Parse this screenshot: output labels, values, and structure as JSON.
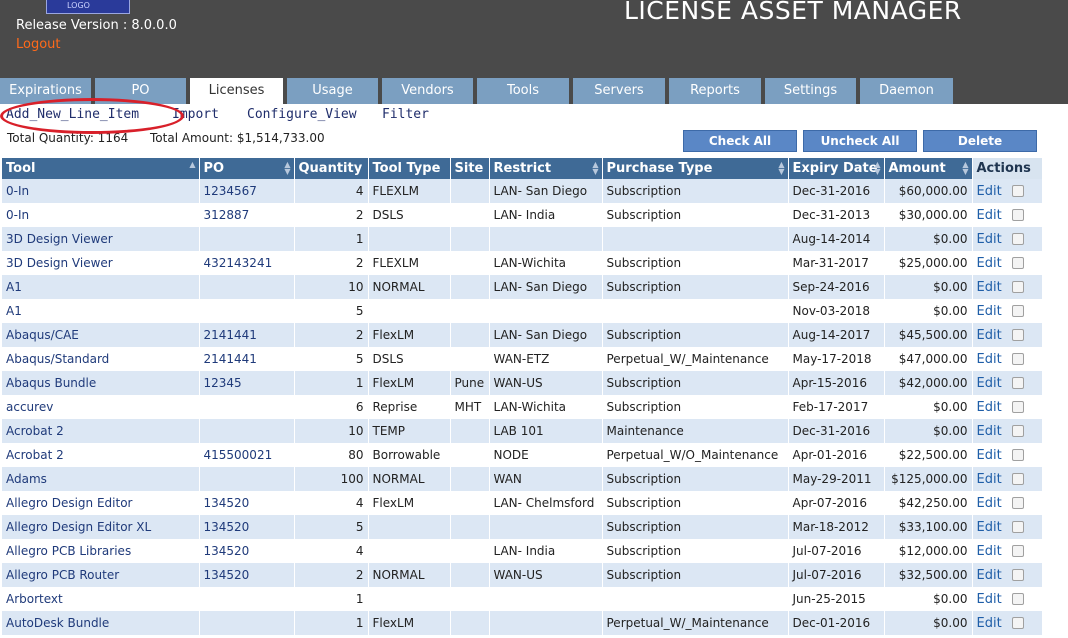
{
  "header": {
    "logo_text": "LOGO",
    "version": "Release Version : 8.0.0.0",
    "logout": "Logout",
    "title": "LICENSE ASSET MANAGER"
  },
  "tabs": [
    "Expirations",
    "PO",
    "Licenses",
    "Usage",
    "Vendors",
    "Tools",
    "Servers",
    "Reports",
    "Settings",
    "Daemon"
  ],
  "active_tab": "Licenses",
  "links": {
    "add": "Add_New_Line_Item",
    "import": "Import",
    "configure": "Configure_View",
    "filter": "Filter"
  },
  "totals": {
    "quantity": "Total Quantity: 1164",
    "amount": "Total Amount: $1,514,733.00"
  },
  "buttons": {
    "check_all": "Check All",
    "uncheck_all": "Uncheck All",
    "delete": "Delete"
  },
  "table": {
    "columns": [
      "Tool",
      "PO",
      "Quantity",
      "Tool Type",
      "Site",
      "Restrict",
      "Purchase Type",
      "Expiry Date",
      "Amount",
      "Actions"
    ],
    "edit_label": "Edit",
    "rows": [
      [
        "0-In",
        "1234567",
        "4",
        "FLEXLM",
        "",
        "LAN- San Diego",
        "Subscription",
        "Dec-31-2016",
        "$60,000.00"
      ],
      [
        "0-In",
        "312887",
        "2",
        "DSLS",
        "",
        "LAN- India",
        "Subscription",
        "Dec-31-2013",
        "$30,000.00"
      ],
      [
        "3D Design Viewer",
        "",
        "1",
        "",
        "",
        "",
        "",
        "Aug-14-2014",
        "$0.00"
      ],
      [
        "3D Design Viewer",
        "432143241",
        "2",
        "FLEXLM",
        "",
        "LAN-Wichita",
        "Subscription",
        "Mar-31-2017",
        "$25,000.00"
      ],
      [
        "A1",
        "",
        "10",
        "NORMAL",
        "",
        "LAN- San Diego",
        "Subscription",
        "Sep-24-2016",
        "$0.00"
      ],
      [
        "A1",
        "",
        "5",
        "",
        "",
        "",
        "",
        "Nov-03-2018",
        "$0.00"
      ],
      [
        "Abaqus/CAE",
        "2141441",
        "2",
        "FlexLM",
        "",
        "LAN- San Diego",
        "Subscription",
        "Aug-14-2017",
        "$45,500.00"
      ],
      [
        "Abaqus/Standard",
        "2141441",
        "5",
        "DSLS",
        "",
        "WAN-ETZ",
        "Perpetual_W/_Maintenance",
        "May-17-2018",
        "$47,000.00"
      ],
      [
        "Abaqus Bundle",
        "12345",
        "1",
        "FlexLM",
        "Pune",
        "WAN-US",
        "Subscription",
        "Apr-15-2016",
        "$42,000.00"
      ],
      [
        "accurev",
        "",
        "6",
        "Reprise",
        "MHT",
        "LAN-Wichita",
        "Subscription",
        "Feb-17-2017",
        "$0.00"
      ],
      [
        "Acrobat 2",
        "",
        "10",
        "TEMP",
        "",
        "LAB 101",
        "Maintenance",
        "Dec-31-2016",
        "$0.00"
      ],
      [
        "Acrobat 2",
        "415500021",
        "80",
        "Borrowable",
        "",
        "NODE",
        "Perpetual_W/O_Maintenance",
        "Apr-01-2016",
        "$22,500.00"
      ],
      [
        "Adams",
        "",
        "100",
        "NORMAL",
        "",
        "WAN",
        "Subscription",
        "May-29-2011",
        "$125,000.00"
      ],
      [
        "Allegro Design Editor",
        "134520",
        "4",
        "FlexLM",
        "",
        "LAN- Chelmsford",
        "Subscription",
        "Apr-07-2016",
        "$42,250.00"
      ],
      [
        "Allegro Design Editor XL",
        "134520",
        "5",
        "",
        "",
        "",
        "Subscription",
        "Mar-18-2012",
        "$33,100.00"
      ],
      [
        "Allegro PCB Libraries",
        "134520",
        "4",
        "",
        "",
        "LAN- India",
        "Subscription",
        "Jul-07-2016",
        "$12,000.00"
      ],
      [
        "Allegro PCB Router",
        "134520",
        "2",
        "NORMAL",
        "",
        "WAN-US",
        "Subscription",
        "Jul-07-2016",
        "$32,500.00"
      ],
      [
        "Arbortext",
        "",
        "1",
        "",
        "",
        "",
        "",
        "Jun-25-2015",
        "$0.00"
      ],
      [
        "AutoDesk Bundle",
        "",
        "1",
        "FlexLM",
        "",
        "",
        "Perpetual_W/_Maintenance",
        "Dec-01-2016",
        "$0.00"
      ]
    ]
  }
}
